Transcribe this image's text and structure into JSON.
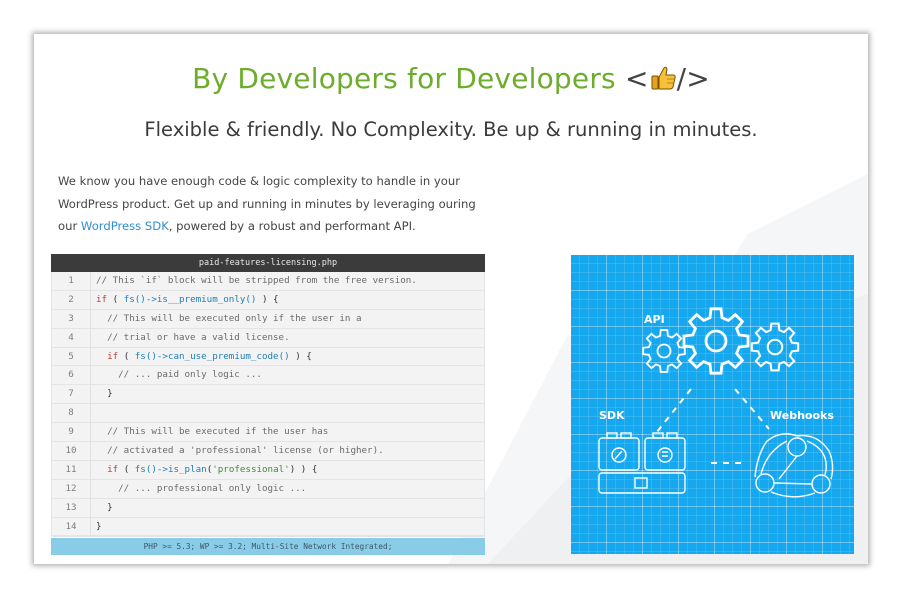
{
  "header": {
    "title": "By Developers for Developers",
    "title_tag_open": "<",
    "title_tag_close": "/>",
    "subtitle": "Flexible & friendly. No Complexity. Be up & running in minutes."
  },
  "intro": {
    "line1": "We know you have enough code & logic complexity to handle in your",
    "line2": "WordPress product. Get up and running in minutes by leveraging ouring",
    "line3_before": "our ",
    "link": "WordPress SDK",
    "line3_after": ", powered by a robust and performant API."
  },
  "code": {
    "filename": "paid-features-licensing.php",
    "footer": "PHP >= 5.3; WP >= 3.2; Multi-Site Network Integrated;",
    "lines": [
      {
        "n": "1",
        "text": "// This `if` block will be stripped from the free version."
      },
      {
        "n": "2",
        "text": "if ( fs()->is__premium_only() ) {"
      },
      {
        "n": "3",
        "text": "  // This will be executed only if the user in a"
      },
      {
        "n": "4",
        "text": "  // trial or have a valid license."
      },
      {
        "n": "5",
        "text": "  if ( fs()->can_use_premium_code() ) {"
      },
      {
        "n": "6",
        "text": "    // ... paid only logic ..."
      },
      {
        "n": "7",
        "text": "  }"
      },
      {
        "n": "8",
        "text": ""
      },
      {
        "n": "9",
        "text": "  // This will be executed if the user has"
      },
      {
        "n": "10",
        "text": "  // activated a 'professional' license (or higher)."
      },
      {
        "n": "11",
        "text": "  if ( fs()->is_plan('professional') ) {"
      },
      {
        "n": "12",
        "text": "    // ... professional only logic ..."
      },
      {
        "n": "13",
        "text": "  }"
      },
      {
        "n": "14",
        "text": "}"
      }
    ]
  },
  "blueprint": {
    "api_label": "API",
    "sdk_label": "SDK",
    "webhooks_label": "Webhooks"
  },
  "colors": {
    "title_green": "#6cad2c",
    "link_blue": "#2e8ecf",
    "blueprint_blue": "#16a8ee",
    "footer_blue": "#89cce8"
  }
}
